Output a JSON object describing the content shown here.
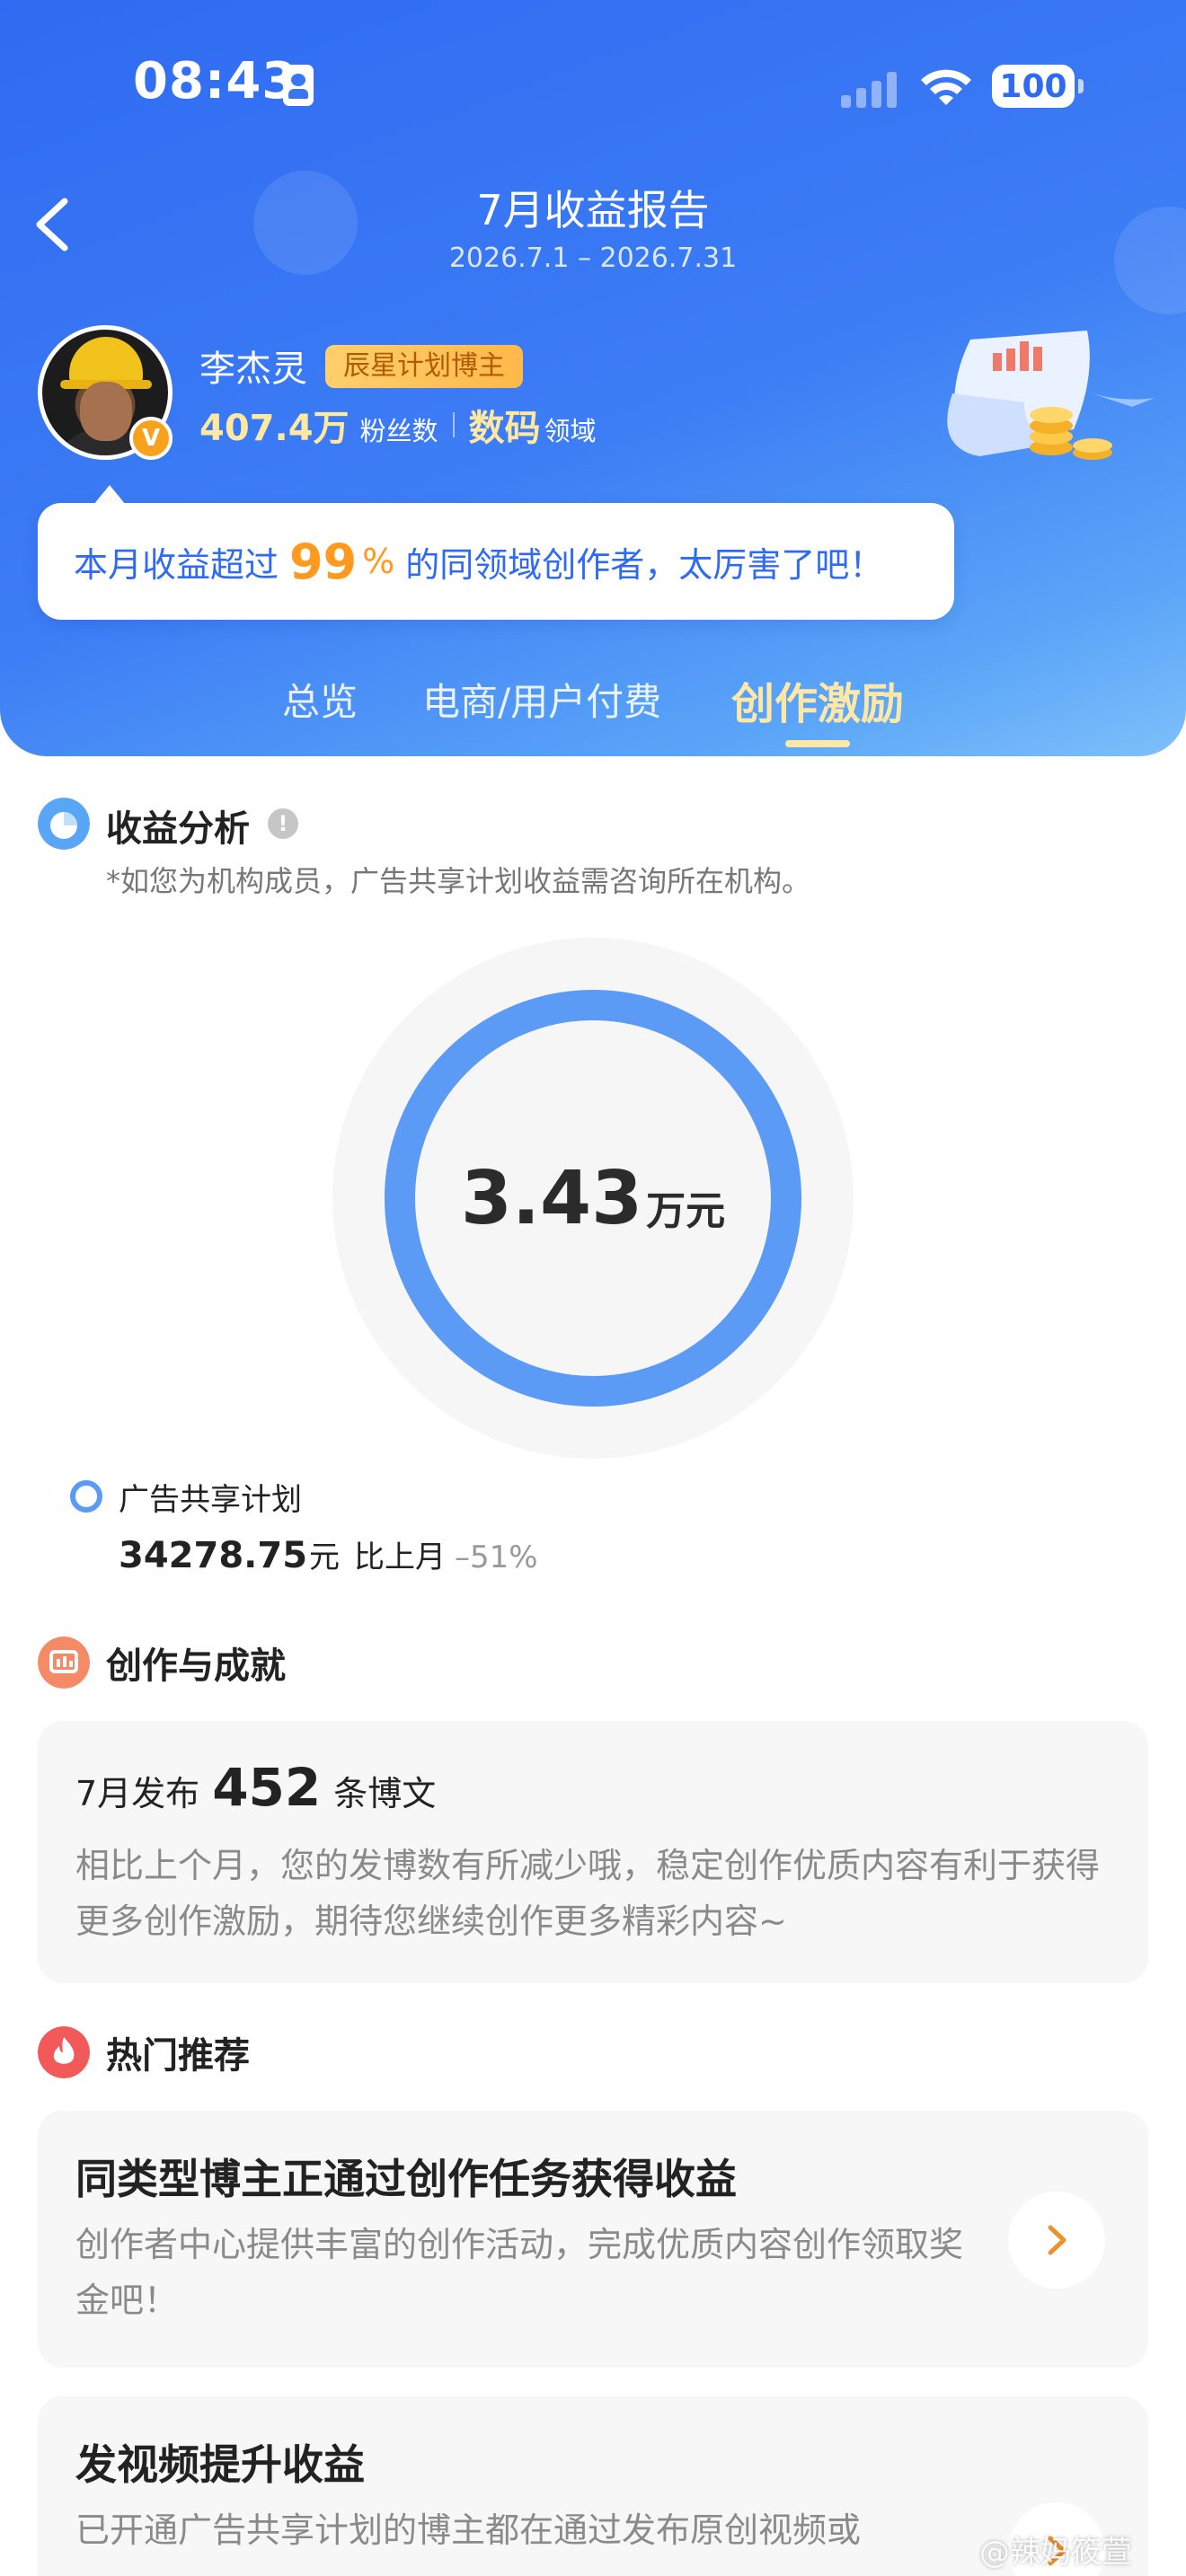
{
  "status_bar": {
    "time": "08:43",
    "battery": "100"
  },
  "header": {
    "title": "7月收益报告",
    "date_range": "2026.7.1 – 2026.7.31"
  },
  "user": {
    "name": "李杰灵",
    "badge": "辰星计划博主",
    "followers_value": "407.4万",
    "followers_label": "粉丝数",
    "domain_value": "数码",
    "domain_label": "领域",
    "verified_mark": "V"
  },
  "callout": {
    "prefix": "本月收益超过",
    "percent": "99",
    "percent_sign": "%",
    "suffix": "的同领域创作者，太厉害了吧！"
  },
  "tabs": [
    {
      "label": "总览",
      "active": false
    },
    {
      "label": "电商/用户付费",
      "active": false
    },
    {
      "label": "创作激励",
      "active": true
    }
  ],
  "income_analysis": {
    "title": "收益分析",
    "info_icon": "!",
    "note": "*如您为机构成员，广告共享计划收益需咨询所在机构。",
    "total_value": "3.43",
    "total_unit": "万元",
    "ring_fraction": 1.0,
    "ring_color": "#5b9af5",
    "legend": {
      "label": "广告共享计划",
      "value": "34278.75",
      "unit": "元",
      "compare_label": "比上月",
      "change": "–51%"
    }
  },
  "achievement": {
    "title": "创作与成就",
    "line_prefix": "7月发布",
    "post_count": "452",
    "line_suffix": "条博文",
    "description": "相比上个月，您的发博数有所减少哦，稳定创作优质内容有利于获得更多创作激励，期待您继续创作更多精彩内容~"
  },
  "hot": {
    "title": "热门推荐",
    "cards": [
      {
        "title": "同类型博主正通过创作任务获得收益",
        "description": "创作者中心提供丰富的创作活动，完成优质内容创作领取奖金吧！"
      },
      {
        "title": "发视频提升收益",
        "description": "已开通广告共享计划的博主都在通过发布原创视频或"
      }
    ]
  },
  "watermark": "@辣妈筱萱",
  "colors": {
    "header_blue": "#3d7df5",
    "accent_orange": "#ff9a1f",
    "tab_active": "#ffe7a6"
  }
}
